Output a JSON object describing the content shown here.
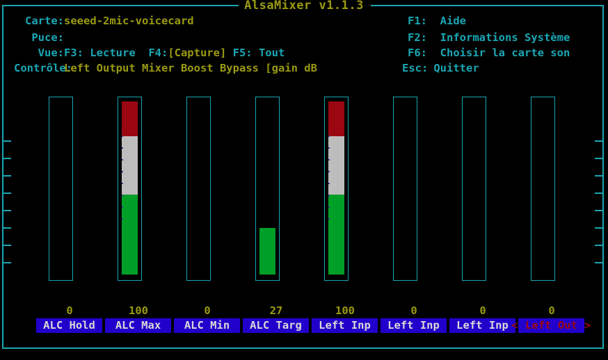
{
  "window": {
    "title": "AlsaMixer v1.1.3"
  },
  "header": {
    "left": [
      {
        "label": "Carte:",
        "value": "seeed-2mic-voicecard",
        "value_style": "yellow"
      },
      {
        "label": "Puce:",
        "value": "",
        "value_style": "yellow"
      },
      {
        "label": "Vue:",
        "value": "",
        "value_style": "mixed",
        "view_parts": [
          {
            "text": "F3: Lecture  F4:",
            "style": "cyan"
          },
          {
            "text": "[Capture]",
            "style": "yellow"
          },
          {
            "text": " F5: Tout",
            "style": "cyan"
          }
        ]
      },
      {
        "label": "Contrôle:",
        "value": "Left Output Mixer Boost Bypass [gain dB",
        "value_style": "yellow"
      }
    ],
    "right": [
      {
        "key": "F1:",
        "action": "Aide"
      },
      {
        "key": "F2:",
        "action": "Informations Système"
      },
      {
        "key": "F6:",
        "action": "Choisir la carte son"
      },
      {
        "key": "Esc:",
        "action": "Quitter"
      }
    ]
  },
  "mixer": {
    "channels": [
      {
        "name": "ALC Hold",
        "value": "0",
        "level": 0,
        "selected": false,
        "segments": []
      },
      {
        "name": "ALC Max",
        "value": "100",
        "level": 100,
        "selected": false,
        "segments": [
          {
            "color": "green",
            "pct": 46
          },
          {
            "color": "gray",
            "pct": 34
          },
          {
            "color": "red",
            "pct": 20
          }
        ]
      },
      {
        "name": "ALC Min",
        "value": "0",
        "level": 0,
        "selected": false,
        "segments": []
      },
      {
        "name": "ALC Targ",
        "value": "27",
        "level": 27,
        "selected": false,
        "segments": [
          {
            "color": "green",
            "pct": 27
          }
        ]
      },
      {
        "name": "Left Inp",
        "value": "100",
        "level": 100,
        "selected": false,
        "segments": [
          {
            "color": "green",
            "pct": 46
          },
          {
            "color": "gray",
            "pct": 34
          },
          {
            "color": "red",
            "pct": 20
          }
        ]
      },
      {
        "name": "Left Inp",
        "value": "0",
        "level": 0,
        "selected": false,
        "segments": []
      },
      {
        "name": "Left Inp",
        "value": "0",
        "level": 0,
        "selected": false,
        "segments": []
      },
      {
        "name": "Left Out",
        "value": "0",
        "level": 0,
        "selected": true,
        "segments": []
      }
    ],
    "selection_bracket_left": "<",
    "selection_bracket_right": ">"
  },
  "colors": {
    "frame": "#1aa7b5",
    "title": "#9a9a12",
    "label_bg": "#2200cc",
    "label_fg": "#d8d8d8",
    "selected_fg": "#9a0711",
    "bar_green": "#00a028",
    "bar_gray": "#bdbdbd",
    "bar_red": "#9a0711",
    "background": "#000000"
  }
}
